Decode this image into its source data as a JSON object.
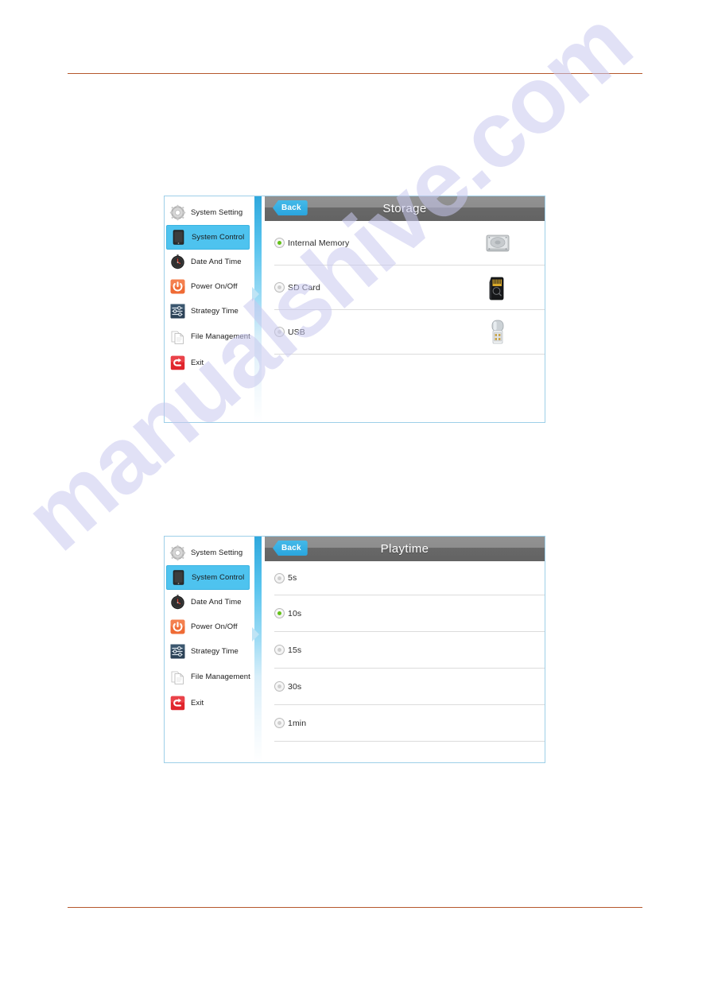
{
  "document": {
    "background_color": "#ffffff",
    "rule_color": "#b5572c",
    "watermark_text": "manualshive.com",
    "watermark_color": "#c9c9ef"
  },
  "theme": {
    "accent_blue": "#4ec3ef",
    "back_button_blue": "#2aa6de",
    "titlebar_grey": "#6b6b6b",
    "selected_radio_green": "#63c117",
    "panel_border": "#9ecfe8"
  },
  "sidebar": {
    "items": [
      {
        "label": "System Setting",
        "icon": "gear-icon",
        "active": false
      },
      {
        "label": "System Control",
        "icon": "tablet-icon",
        "active": true
      },
      {
        "label": "Date And Time",
        "icon": "clock-icon",
        "active": false
      },
      {
        "label": "Power On/Off",
        "icon": "power-icon",
        "active": false
      },
      {
        "label": "Strategy Time",
        "icon": "strategy-icon",
        "active": false
      },
      {
        "label": "File Management",
        "icon": "file-icon",
        "active": false
      },
      {
        "label": "Exit",
        "icon": "exit-icon",
        "active": false
      }
    ]
  },
  "panels": [
    {
      "id": "storage",
      "title": "Storage",
      "back_label": "Back",
      "options": [
        {
          "label": "Internal Memory",
          "selected": true,
          "icon": "hard-drive-icon"
        },
        {
          "label": "SD Card",
          "selected": false,
          "icon": "sd-card-icon"
        },
        {
          "label": "USB",
          "selected": false,
          "icon": "usb-drive-icon"
        }
      ]
    },
    {
      "id": "playtime",
      "title": "Playtime",
      "back_label": "Back",
      "options": [
        {
          "label": "5s",
          "selected": false,
          "icon": null
        },
        {
          "label": "10s",
          "selected": true,
          "icon": null
        },
        {
          "label": "15s",
          "selected": false,
          "icon": null
        },
        {
          "label": "30s",
          "selected": false,
          "icon": null
        },
        {
          "label": "1min",
          "selected": false,
          "icon": null
        }
      ]
    }
  ]
}
